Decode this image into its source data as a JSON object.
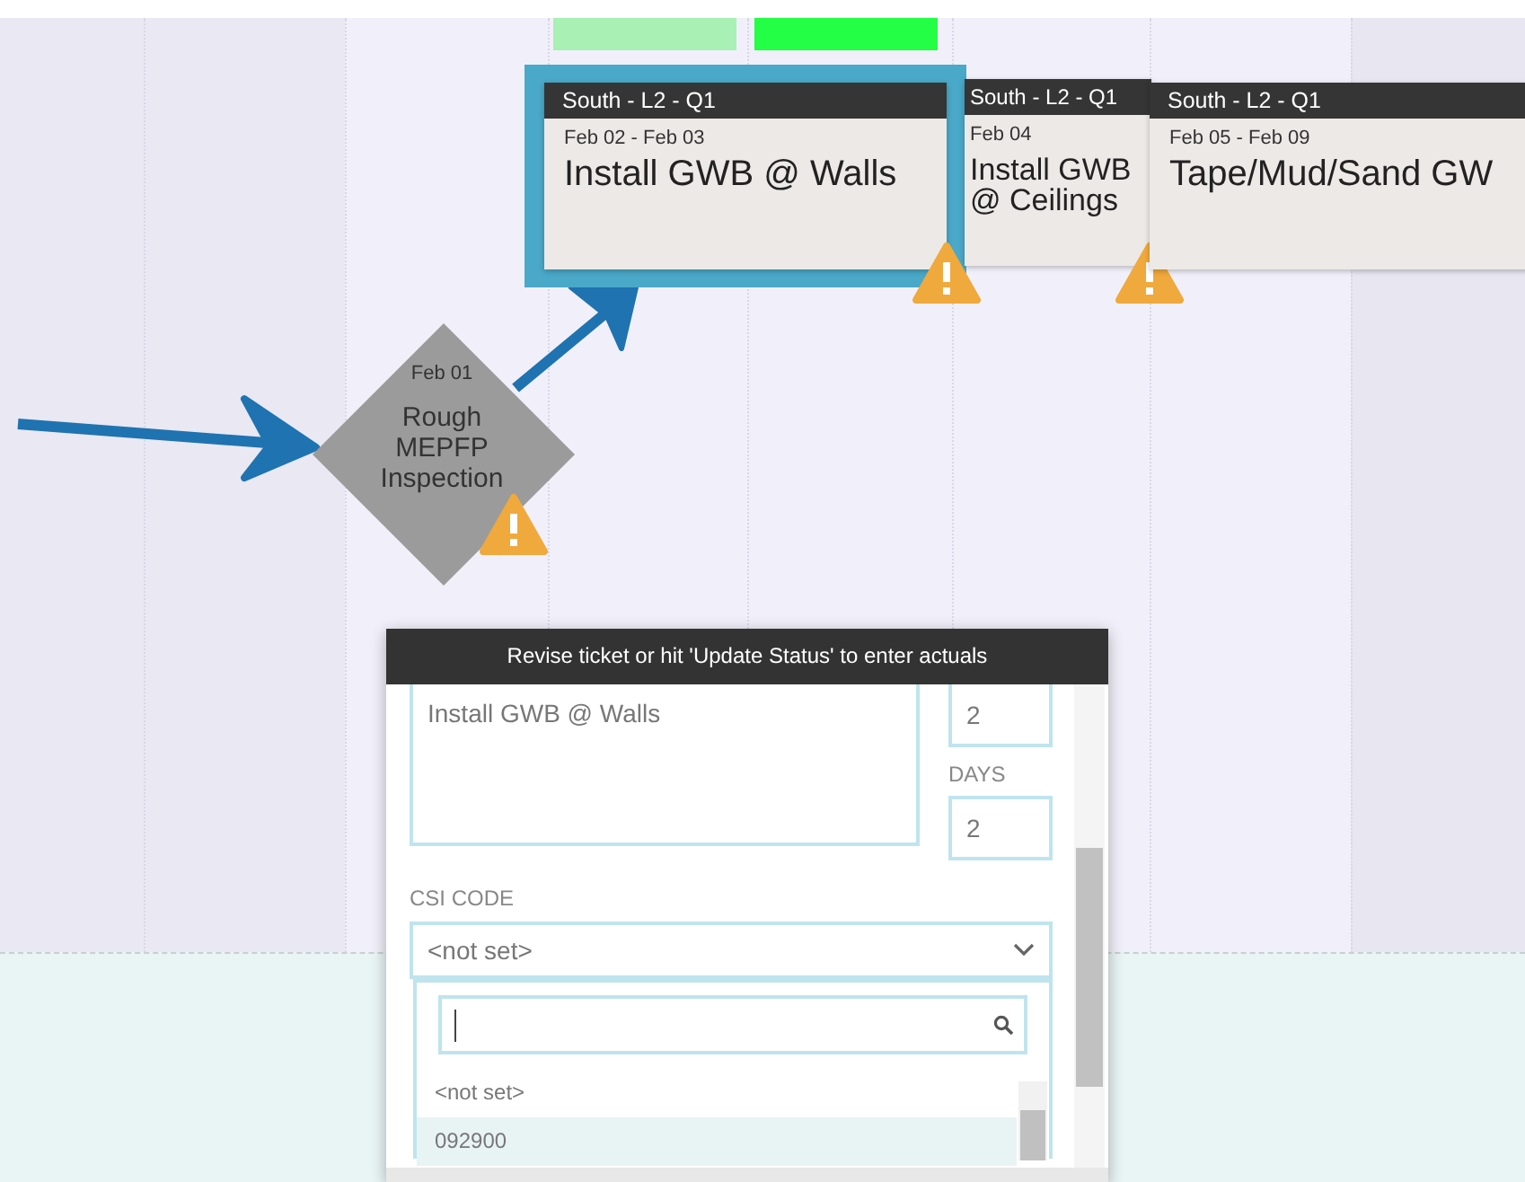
{
  "board": {
    "progress_bars": [
      {
        "color": "#a8f0b4"
      },
      {
        "color": "#22ff44"
      }
    ],
    "cards": [
      {
        "location": "South - L2 - Q1",
        "dates": "Feb 02 - Feb 03",
        "title": "Install GWB @ Walls",
        "selected": true,
        "warning": true
      },
      {
        "location": "South - L2 - Q1",
        "dates": "Feb 04",
        "title": "Install GWB @ Ceilings",
        "selected": false,
        "warning": true
      },
      {
        "location": "South - L2 - Q1",
        "dates": "Feb 05 - Feb 09",
        "title": "Tape/Mud/Sand GW",
        "selected": false,
        "warning": false
      }
    ],
    "milestone": {
      "date": "Feb 01",
      "title": "Rough MEPFP Inspection",
      "warning": true
    }
  },
  "ticket_popup": {
    "header": "Revise ticket or hit 'Update Status' to enter actuals",
    "description": "Install GWB @ Walls",
    "quantity": "2",
    "days_label": "DAYS",
    "days": "2",
    "csi_label": "CSI CODE",
    "csi_value": "<not set>",
    "dropdown": {
      "options": [
        {
          "label": "<not set>",
          "selected": false
        },
        {
          "label": "092900",
          "selected": true
        }
      ]
    }
  }
}
